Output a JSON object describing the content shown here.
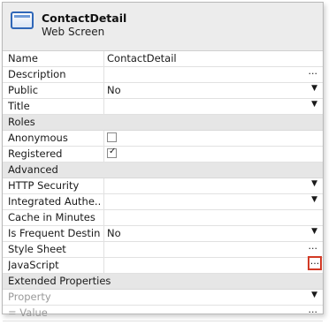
{
  "header": {
    "title": "ContactDetail",
    "subtitle": "Web Screen"
  },
  "rows": {
    "name": {
      "label": "Name",
      "value": "ContactDetail"
    },
    "description": {
      "label": "Description"
    },
    "public": {
      "label": "Public",
      "value": "No"
    },
    "title": {
      "label": "Title"
    },
    "roles_section": "Roles",
    "anonymous": {
      "label": "Anonymous",
      "checked": false
    },
    "registered": {
      "label": "Registered",
      "checked": true
    },
    "advanced_section": "Advanced",
    "http_security": {
      "label": "HTTP Security"
    },
    "integrated_auth": {
      "label": "Integrated Authe..."
    },
    "cache_minutes": {
      "label": "Cache in Minutes"
    },
    "frequent_dest": {
      "label": "Is Frequent Destin...",
      "value": "No"
    },
    "style_sheet": {
      "label": "Style Sheet"
    },
    "javascript": {
      "label": "JavaScript"
    },
    "extended_section": "Extended Properties",
    "property": {
      "placeholder": "Property"
    },
    "value": {
      "placeholder": "=  Value"
    }
  },
  "glyphs": {
    "ellipsis": "...",
    "dropdown": "▼"
  },
  "colors": {
    "highlight": "#d23a26",
    "icon_blue": "#2f67b8",
    "section_bg": "#e6e6e6"
  }
}
